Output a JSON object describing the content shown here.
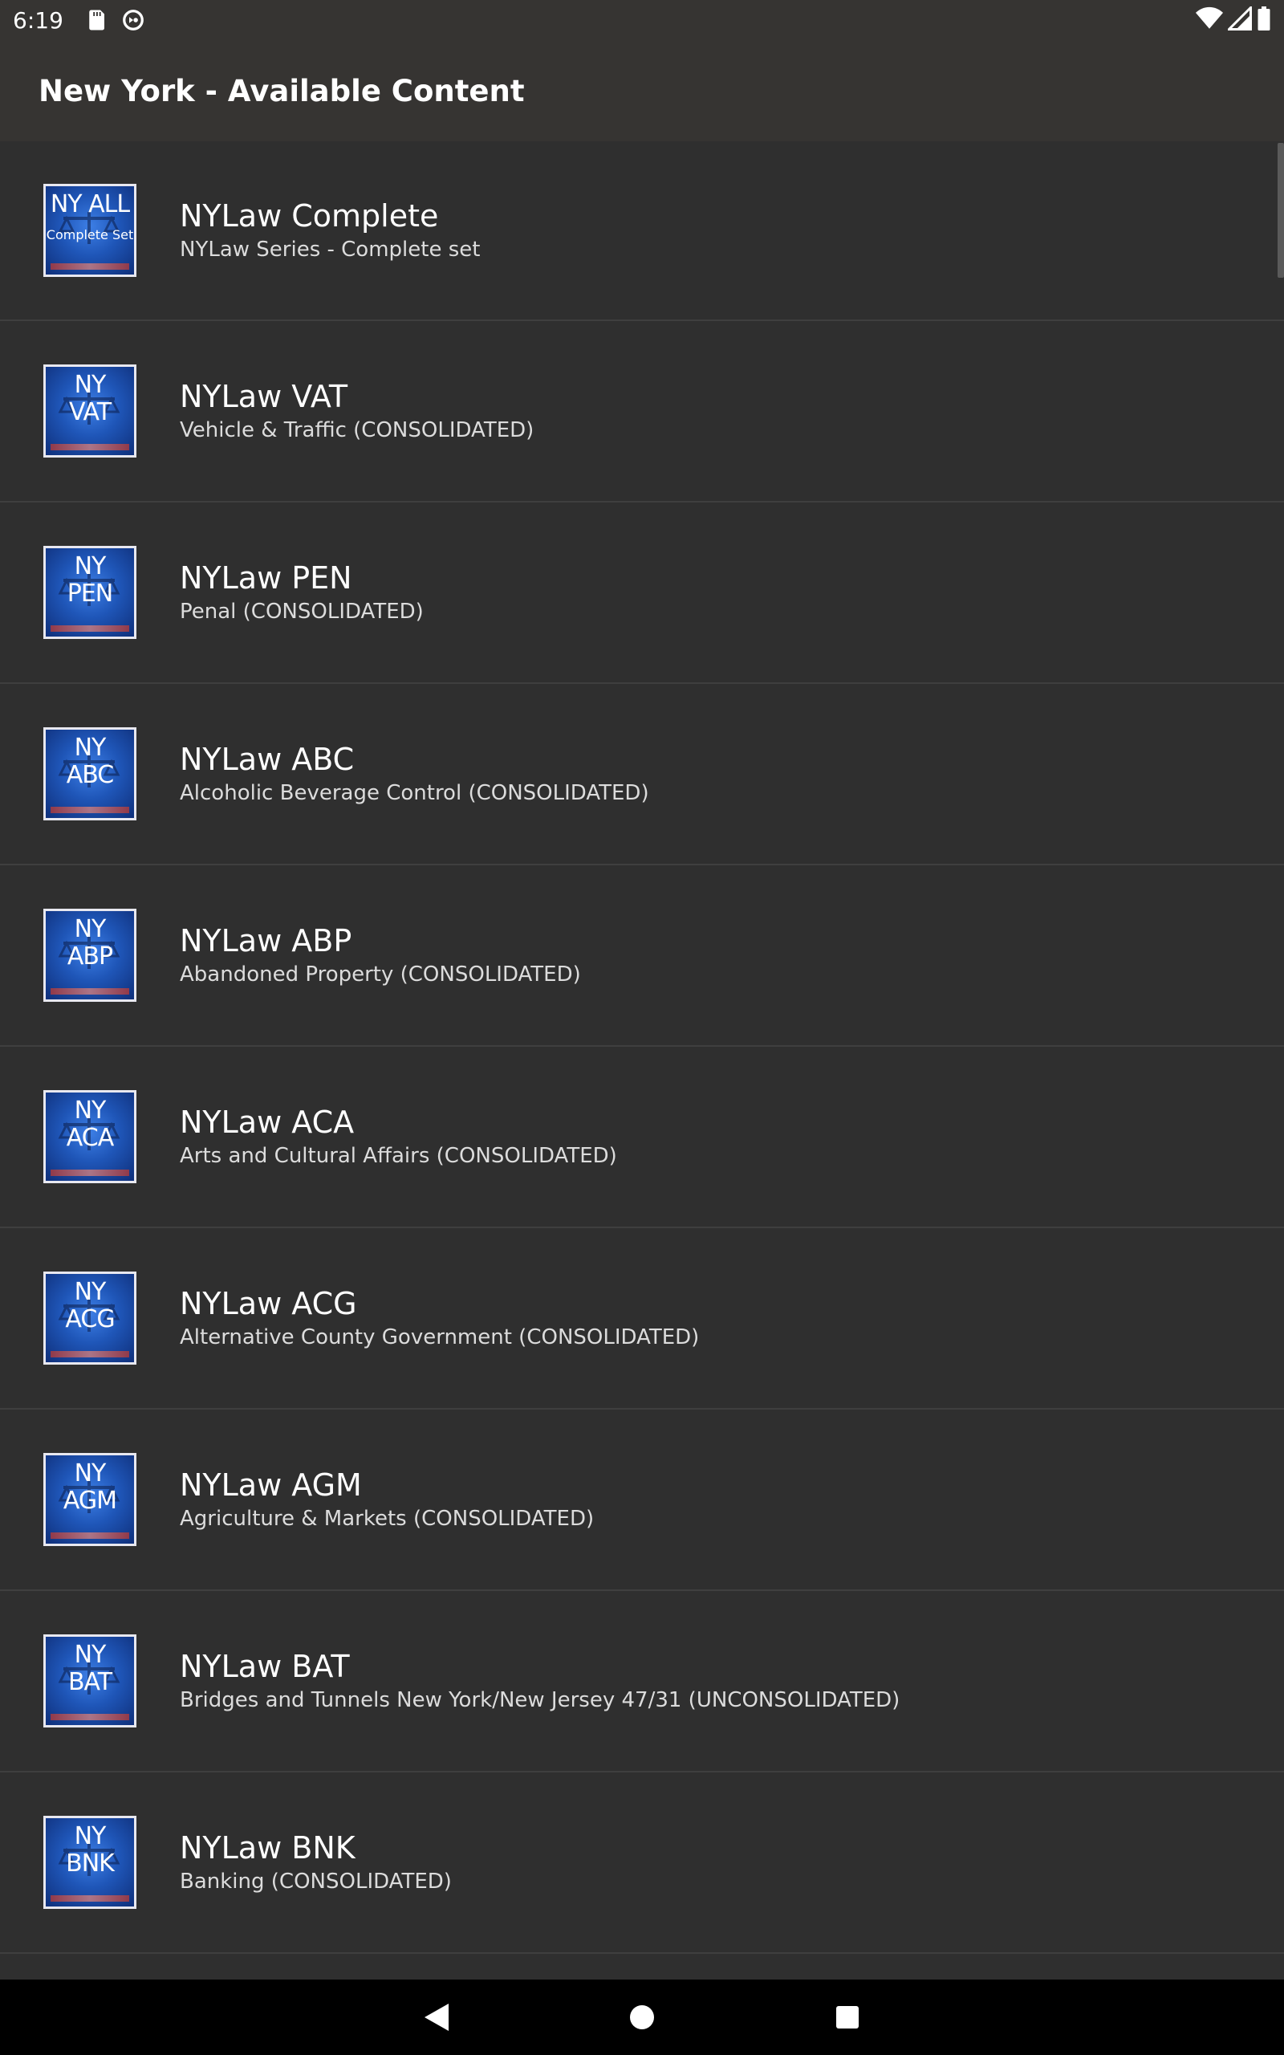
{
  "status_bar": {
    "time": "6:19",
    "left_icons": [
      "sd-card-icon",
      "sync-icon"
    ],
    "right_icons": [
      "wifi-icon",
      "cell-signal-icon",
      "battery-icon"
    ]
  },
  "app_bar": {
    "title": "New York - Available Content"
  },
  "items": [
    {
      "icon_line1": "NY ALL",
      "icon_line2": "Complete Set",
      "title": "NYLaw Complete",
      "subtitle": "NYLaw Series - Complete set"
    },
    {
      "icon_line1": "NY",
      "icon_line2": "VAT",
      "title": "NYLaw VAT",
      "subtitle": "Vehicle & Traffic (CONSOLIDATED)"
    },
    {
      "icon_line1": "NY",
      "icon_line2": "PEN",
      "title": "NYLaw PEN",
      "subtitle": "Penal (CONSOLIDATED)"
    },
    {
      "icon_line1": "NY",
      "icon_line2": "ABC",
      "title": "NYLaw ABC",
      "subtitle": "Alcoholic Beverage Control (CONSOLIDATED)"
    },
    {
      "icon_line1": "NY",
      "icon_line2": "ABP",
      "title": "NYLaw ABP",
      "subtitle": "Abandoned Property (CONSOLIDATED)"
    },
    {
      "icon_line1": "NY",
      "icon_line2": "ACA",
      "title": "NYLaw ACA",
      "subtitle": "Arts and Cultural Affairs (CONSOLIDATED)"
    },
    {
      "icon_line1": "NY",
      "icon_line2": "ACG",
      "title": "NYLaw ACG",
      "subtitle": "Alternative County Government (CONSOLIDATED)"
    },
    {
      "icon_line1": "NY",
      "icon_line2": "AGM",
      "title": "NYLaw AGM",
      "subtitle": "Agriculture & Markets (CONSOLIDATED)"
    },
    {
      "icon_line1": "NY",
      "icon_line2": "BAT",
      "title": "NYLaw BAT",
      "subtitle": "Bridges and Tunnels New York/New Jersey 47/31 (UNCONSOLIDATED)"
    },
    {
      "icon_line1": "NY",
      "icon_line2": "BNK",
      "title": "NYLaw BNK",
      "subtitle": "Banking (CONSOLIDATED)"
    }
  ],
  "nav_bar": {
    "buttons": [
      "back-icon",
      "home-icon",
      "recents-icon"
    ]
  },
  "colors": {
    "background": "#2f2f2f",
    "app_bar": "#363432",
    "divider": "#3f3f3f",
    "icon_blue": "#1f56b8"
  }
}
